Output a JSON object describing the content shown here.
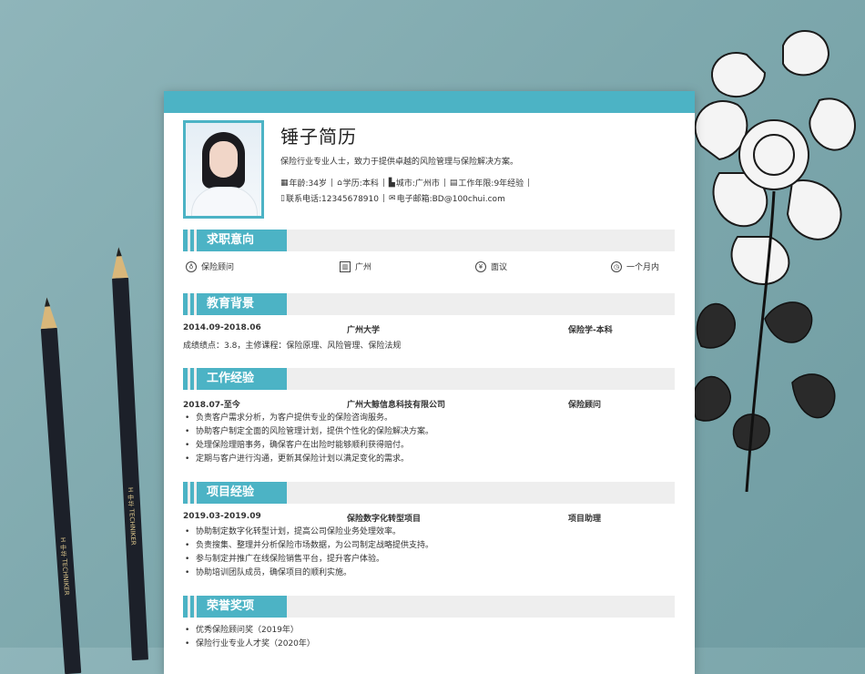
{
  "resume": {
    "name": "锤子简历",
    "intro": "保险行业专业人士，致力于提供卓越的风险管理与保险解决方案。",
    "info": {
      "age": "年龄:34岁",
      "education": "学历:本科",
      "city": "城市:广州市",
      "experience": "工作年限:9年经验",
      "phone": "联系电话:12345678910",
      "email": "电子邮箱:BD@100chui.com"
    },
    "sections": {
      "intent": "求职意向",
      "education": "教育背景",
      "work": "工作经验",
      "project": "项目经验",
      "honors": "荣誉奖项"
    },
    "intent": {
      "position": "保险顾问",
      "city": "广州",
      "salary": "面议",
      "availability": "一个月内"
    },
    "education": {
      "period": "2014.09-2018.06",
      "school": "广州大学",
      "major": "保险学-本科",
      "detail": "成绩绩点：3.8，主修课程：保险原理、风险管理、保险法规"
    },
    "work": {
      "period": "2018.07-至今",
      "company": "广州大鲸信息科技有限公司",
      "role": "保险顾问",
      "bullets": [
        "负责客户需求分析，为客户提供专业的保险咨询服务。",
        "协助客户制定全面的风险管理计划，提供个性化的保险解决方案。",
        "处理保险理赔事务，确保客户在出险时能够顺利获得赔付。",
        "定期与客户进行沟通，更新其保险计划以满足变化的需求。"
      ]
    },
    "project": {
      "period": "2019.03-2019.09",
      "name": "保险数字化转型项目",
      "role": "项目助理",
      "bullets": [
        "协助制定数字化转型计划，提高公司保险业务处理效率。",
        "负责搜集、整理并分析保险市场数据，为公司制定战略提供支持。",
        "参与制定并推广在线保险销售平台，提升客户体验。",
        "协助培训团队成员，确保项目的顺利实施。"
      ]
    },
    "honors": [
      "优秀保险顾问奖（2019年）",
      "保险行业专业人才奖（2020年）"
    ]
  },
  "decor": {
    "pencil_brand": "H 中华 TECHNIKER"
  },
  "colors": {
    "accent": "#4cb3c5",
    "section_bg": "#eeeeee"
  }
}
